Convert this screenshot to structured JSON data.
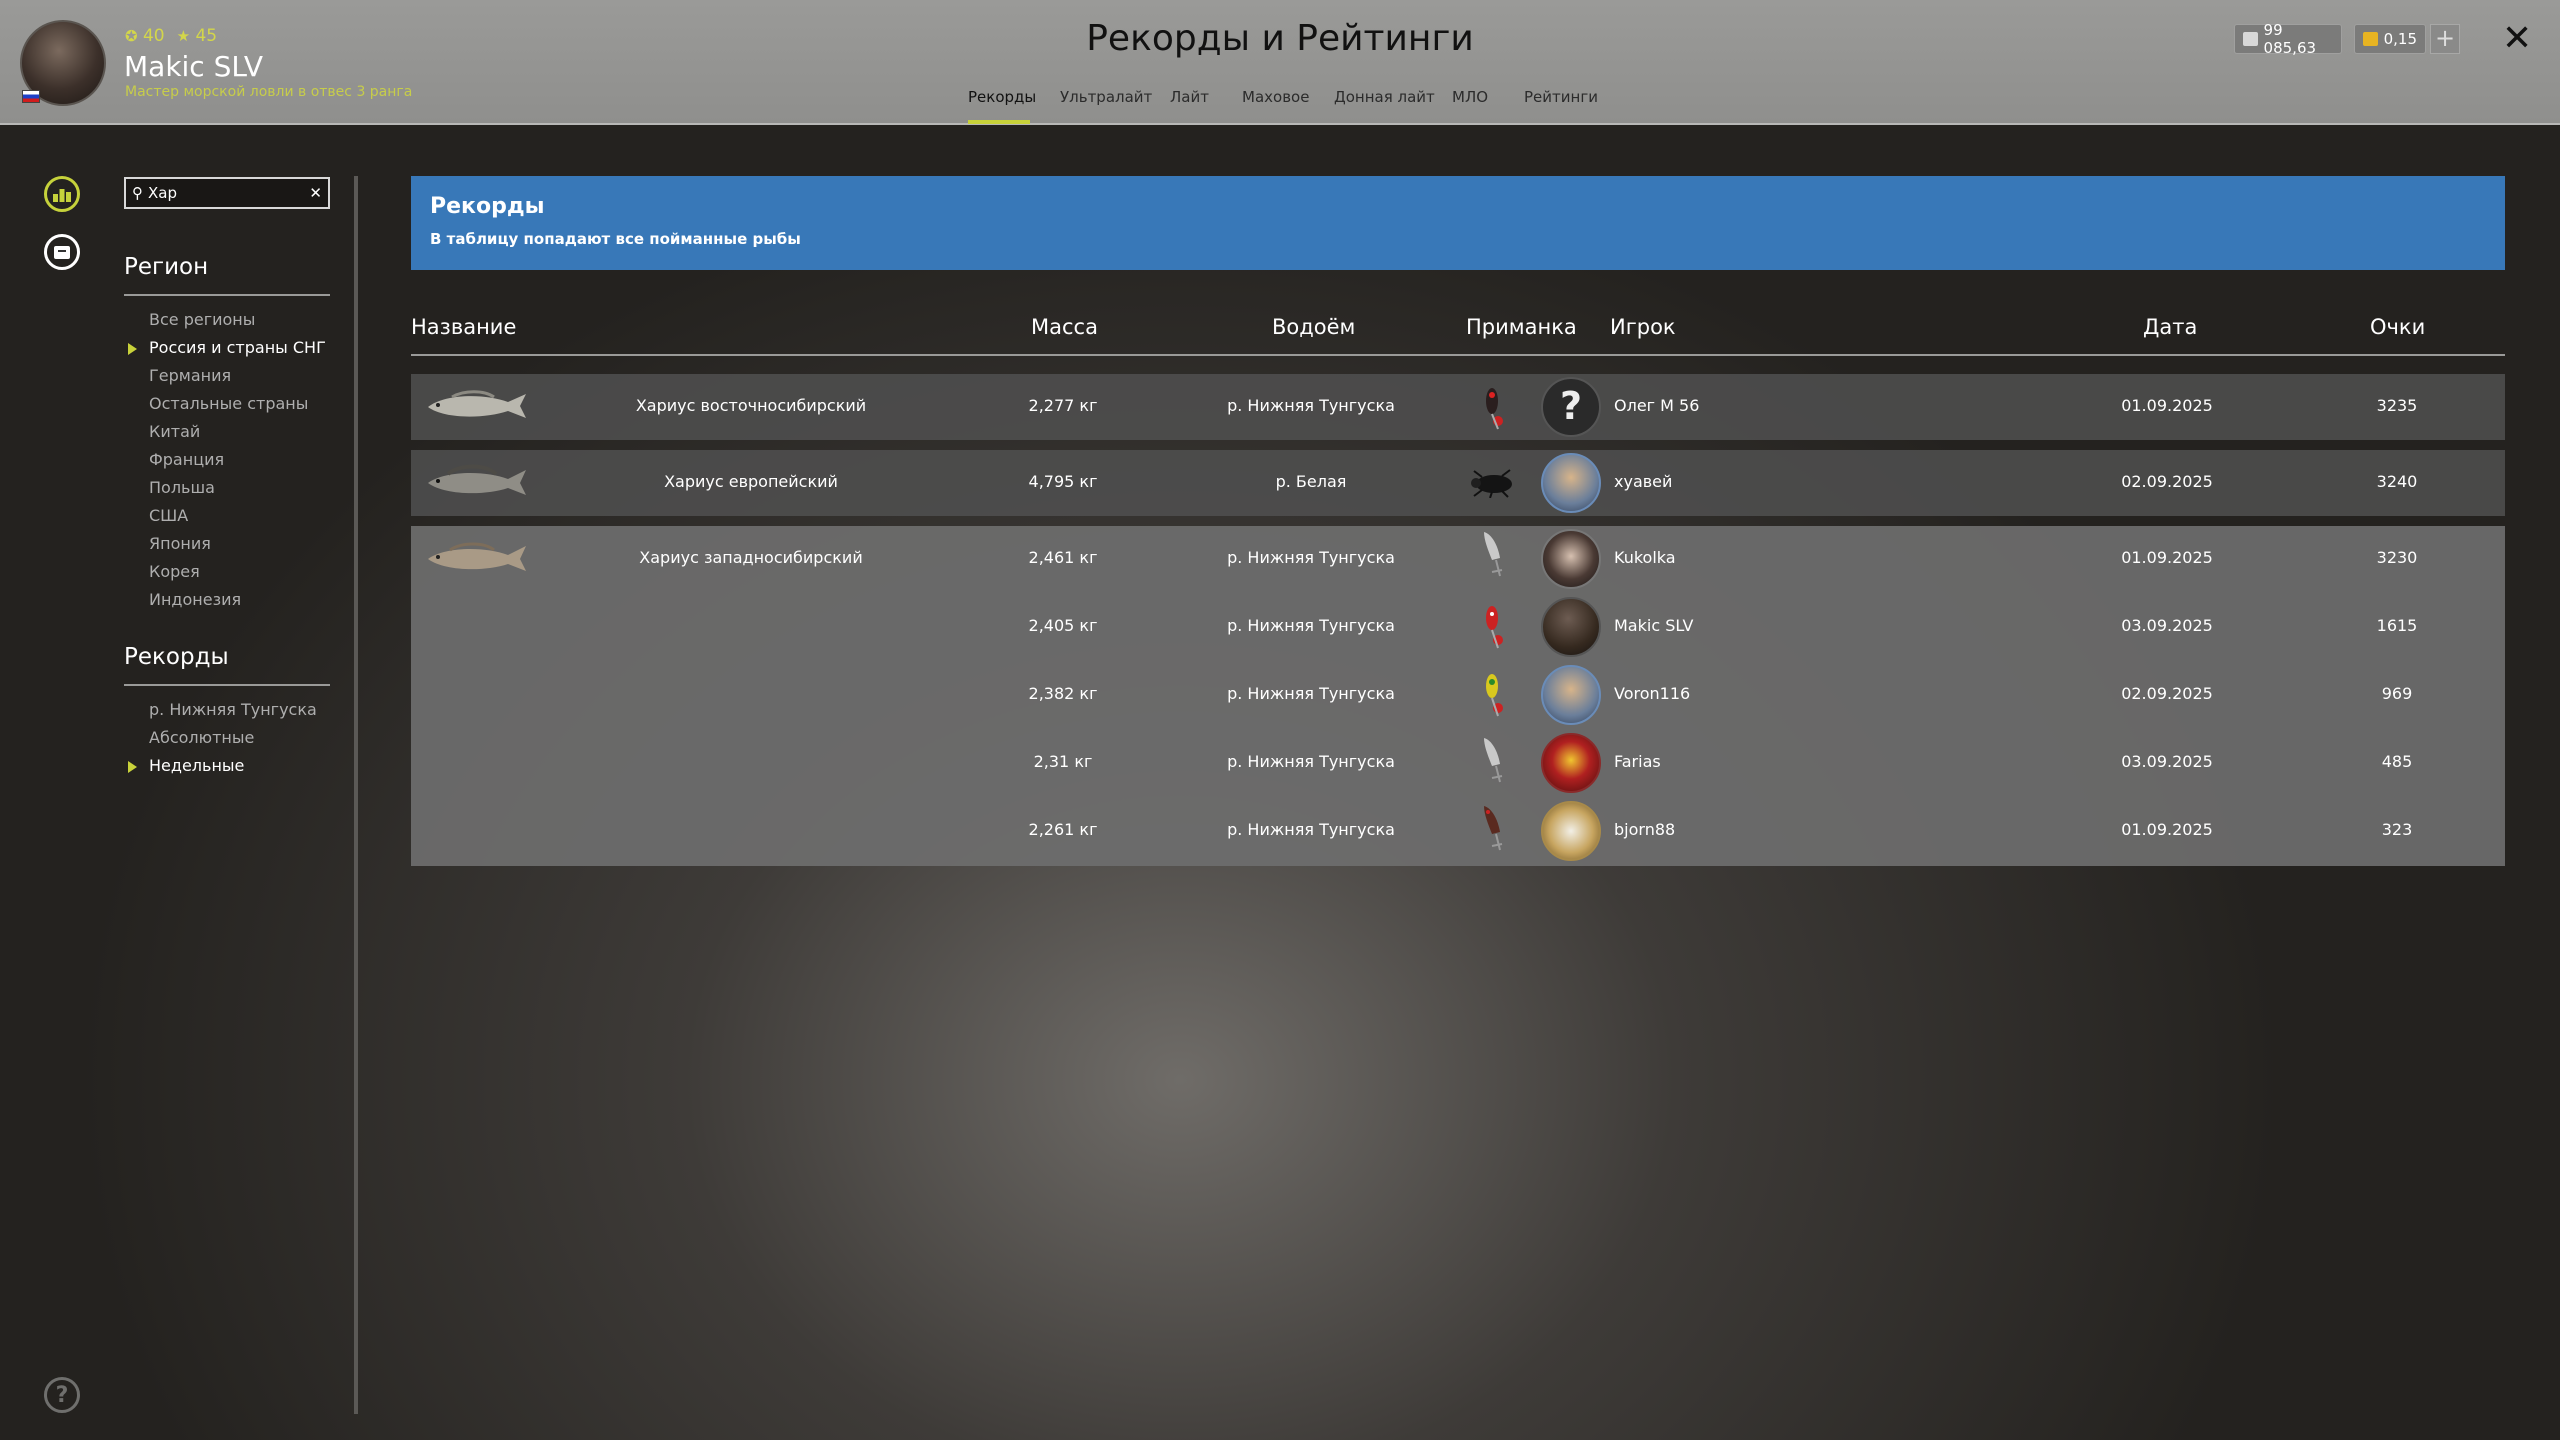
{
  "header": {
    "page_title": "Рекорды и Рейтинги",
    "user": {
      "name": "Makic SLV",
      "level": "40",
      "stars": "45",
      "rank": "Мастер морской ловли в отвес 3 ранга"
    },
    "tabs": [
      "Рекорды",
      "Ультралайт",
      "Лайт",
      "Маховое",
      "Донная лайт",
      "МЛО",
      "Рейтинги"
    ],
    "active_tab": "Рекорды",
    "money": "99 085,63",
    "gold": "0,15",
    "colors": {
      "accent": "#c8d23a",
      "banner": "#3878b8",
      "gold": "#e8b422"
    }
  },
  "sidebar": {
    "search_value": "Хар",
    "region_title": "Регион",
    "regions": [
      "Все регионы",
      "Россия и страны СНГ",
      "Германия",
      "Остальные страны",
      "Китай",
      "Франция",
      "Польша",
      "США",
      "Япония",
      "Корея",
      "Индонезия"
    ],
    "selected_region": "Россия и страны СНГ",
    "records_title": "Рекорды",
    "records": [
      "р. Нижняя Тунгуска",
      "Абсолютные",
      "Недельные"
    ],
    "selected_record": "Недельные"
  },
  "banner": {
    "title": "Рекорды",
    "subtitle": "В таблицу попадают все пойманные рыбы"
  },
  "table": {
    "headers": [
      "Название",
      "Масса",
      "Водоём",
      "Приманка",
      "Игрок",
      "Дата",
      "Очки"
    ],
    "rows": [
      {
        "fish": "Хариус восточносибирский",
        "mass": "2,277 кг",
        "water": "р. Нижняя Тунгуска",
        "player": "Олег М 56",
        "date": "01.09.2025",
        "points": "3235",
        "lure": "spoon-dark-red",
        "avatar": "unknown"
      },
      {
        "fish": "Хариус европейский",
        "mass": "4,795 кг",
        "water": "р. Белая",
        "player": "хуавей",
        "date": "02.09.2025",
        "points": "3240",
        "lure": "beetle",
        "avatar": "fisher-hat"
      },
      {
        "fish": "Хариус западносибирский",
        "mass": "2,461 кг",
        "water": "р. Нижняя Тунгуска",
        "player": "Kukolka",
        "date": "01.09.2025",
        "points": "3230",
        "lure": "wobbler-silver",
        "avatar": "woman"
      },
      {
        "fish": "",
        "mass": "2,405 кг",
        "water": "р. Нижняя Тунгуска",
        "player": "Makic SLV",
        "date": "03.09.2025",
        "points": "1615",
        "lure": "spoon-red",
        "avatar": "pelican"
      },
      {
        "fish": "",
        "mass": "2,382 кг",
        "water": "р. Нижняя Тунгуска",
        "player": "Voron116",
        "date": "02.09.2025",
        "points": "969",
        "lure": "spoon-yellow",
        "avatar": "fisher-hat"
      },
      {
        "fish": "",
        "mass": "2,31 кг",
        "water": "р. Нижняя Тунгуска",
        "player": "Farias",
        "date": "03.09.2025",
        "points": "485",
        "lure": "wobbler-silver",
        "avatar": "emblem"
      },
      {
        "fish": "",
        "mass": "2,261 кг",
        "water": "р. Нижняя Тунгуска",
        "player": "bjorn88",
        "date": "01.09.2025",
        "points": "323",
        "lure": "wobbler-dark",
        "avatar": "unicorn"
      }
    ]
  }
}
